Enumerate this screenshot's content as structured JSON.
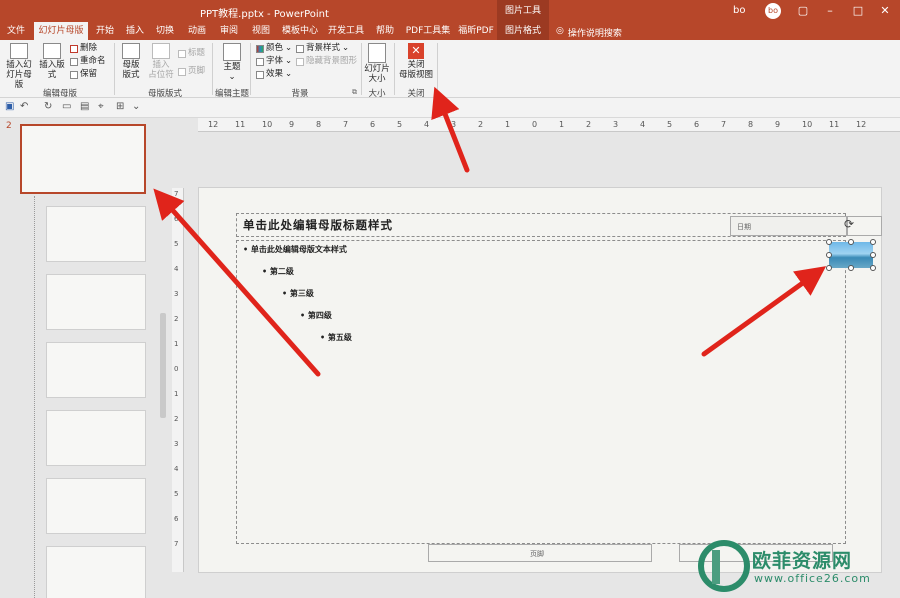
{
  "window": {
    "title": "PPT教程.pptx - PowerPoint",
    "context_group": "图片工具",
    "user": "bo",
    "user_initials": "bo"
  },
  "tabs": [
    "文件",
    "幻灯片母版",
    "开始",
    "插入",
    "切换",
    "动画",
    "审阅",
    "视图",
    "模板中心",
    "开发工具",
    "帮助",
    "PDF工具集",
    "福昕PDF",
    "图片格式"
  ],
  "tell_me": "操作说明搜索",
  "ribbon": {
    "edit_master": {
      "insert_master_l1": "插入幻",
      "insert_master_l2": "灯片母版",
      "insert_layout": "插入版式",
      "delete": "删除",
      "rename": "重命名",
      "preserve": "保留",
      "group": "编辑母版"
    },
    "master_layout": {
      "master_layout_l1": "母版",
      "master_layout_l2": "版式",
      "insert_placeholder_l1": "插入",
      "insert_placeholder_l2": "占位符",
      "title": "标题",
      "footer": "页脚",
      "group": "母版版式"
    },
    "edit_theme": {
      "themes": "主题",
      "group": "编辑主题"
    },
    "background": {
      "colors": "颜色",
      "fonts": "字体",
      "effects": "效果",
      "bg_styles": "背景样式",
      "hide_bg": "隐藏背景图形",
      "group": "背景"
    },
    "size": {
      "slide_size_l1": "幻灯片",
      "slide_size_l2": "大小",
      "group": "大小"
    },
    "close": {
      "close_l1": "关闭",
      "close_l2": "母版视图",
      "group": "关闭"
    }
  },
  "thumbnails": {
    "current_number": "2"
  },
  "ruler": {
    "h_ticks": [
      "12",
      "11",
      "10",
      "9",
      "8",
      "7",
      "6",
      "5",
      "4",
      "3",
      "2",
      "1",
      "0",
      "1",
      "2",
      "3",
      "4",
      "5",
      "6",
      "7",
      "8",
      "9",
      "10",
      "11",
      "12"
    ],
    "v_ticks": [
      "7",
      "6",
      "5",
      "4",
      "3",
      "2",
      "1",
      "0",
      "1",
      "2",
      "3",
      "4",
      "5",
      "6",
      "7"
    ]
  },
  "slide": {
    "title": "单击此处编辑母版标题样式",
    "date": "日期",
    "level1": "单击此处编辑母版文本样式",
    "level2": "第二级",
    "level3": "第三级",
    "level4": "第四级",
    "level5": "第五级",
    "footer": "页脚"
  },
  "watermark": {
    "name": "欧菲资源网",
    "url": "www.office26.com"
  },
  "colors": {
    "accent": "#b7472a",
    "arrow": "#e0241b",
    "watermark": "#2c8c6a"
  }
}
